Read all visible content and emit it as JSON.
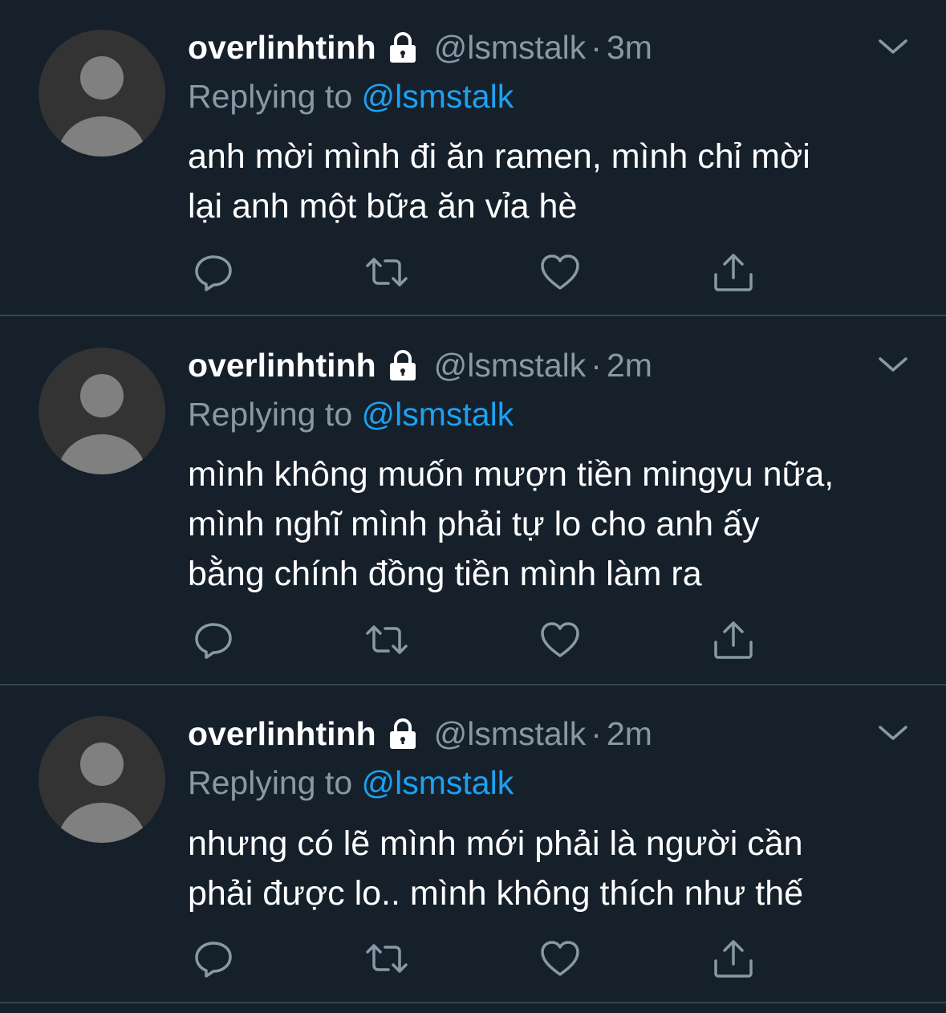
{
  "colors": {
    "background": "#15202b",
    "divider": "#38444d",
    "secondary_text": "#8899a6",
    "mention": "#1da1f2",
    "primary_text": "#ffffff",
    "avatar_bg": "#333333",
    "avatar_fg": "#808080"
  },
  "icons": {
    "lock": "lock-icon",
    "chevron": "chevron-down-icon",
    "reply": "reply-icon",
    "retweet": "retweet-icon",
    "like": "heart-icon",
    "share": "share-icon"
  },
  "tweets": [
    {
      "display_name": "overlinhtinh",
      "handle": "@lsmstalk",
      "separator": "·",
      "time": "3m",
      "replying_prefix": "Replying to",
      "replying_to": "@lsmstalk",
      "lines": [
        "anh mời mình đi ăn ramen, mình chỉ mời",
        "lại anh một bữa ăn vỉa hè"
      ]
    },
    {
      "display_name": "overlinhtinh",
      "handle": "@lsmstalk",
      "separator": "·",
      "time": "2m",
      "replying_prefix": "Replying to",
      "replying_to": "@lsmstalk",
      "lines": [
        "mình không muốn mượn tiền mingyu nữa,",
        "mình nghĩ mình phải tự lo cho anh ấy",
        "bằng chính đồng tiền mình làm ra"
      ]
    },
    {
      "display_name": "overlinhtinh",
      "handle": "@lsmstalk",
      "separator": "·",
      "time": "2m",
      "replying_prefix": "Replying to",
      "replying_to": "@lsmstalk",
      "lines": [
        "nhưng có lẽ mình mới phải là người cần",
        "phải được lo.. mình không thích như thế"
      ]
    }
  ]
}
